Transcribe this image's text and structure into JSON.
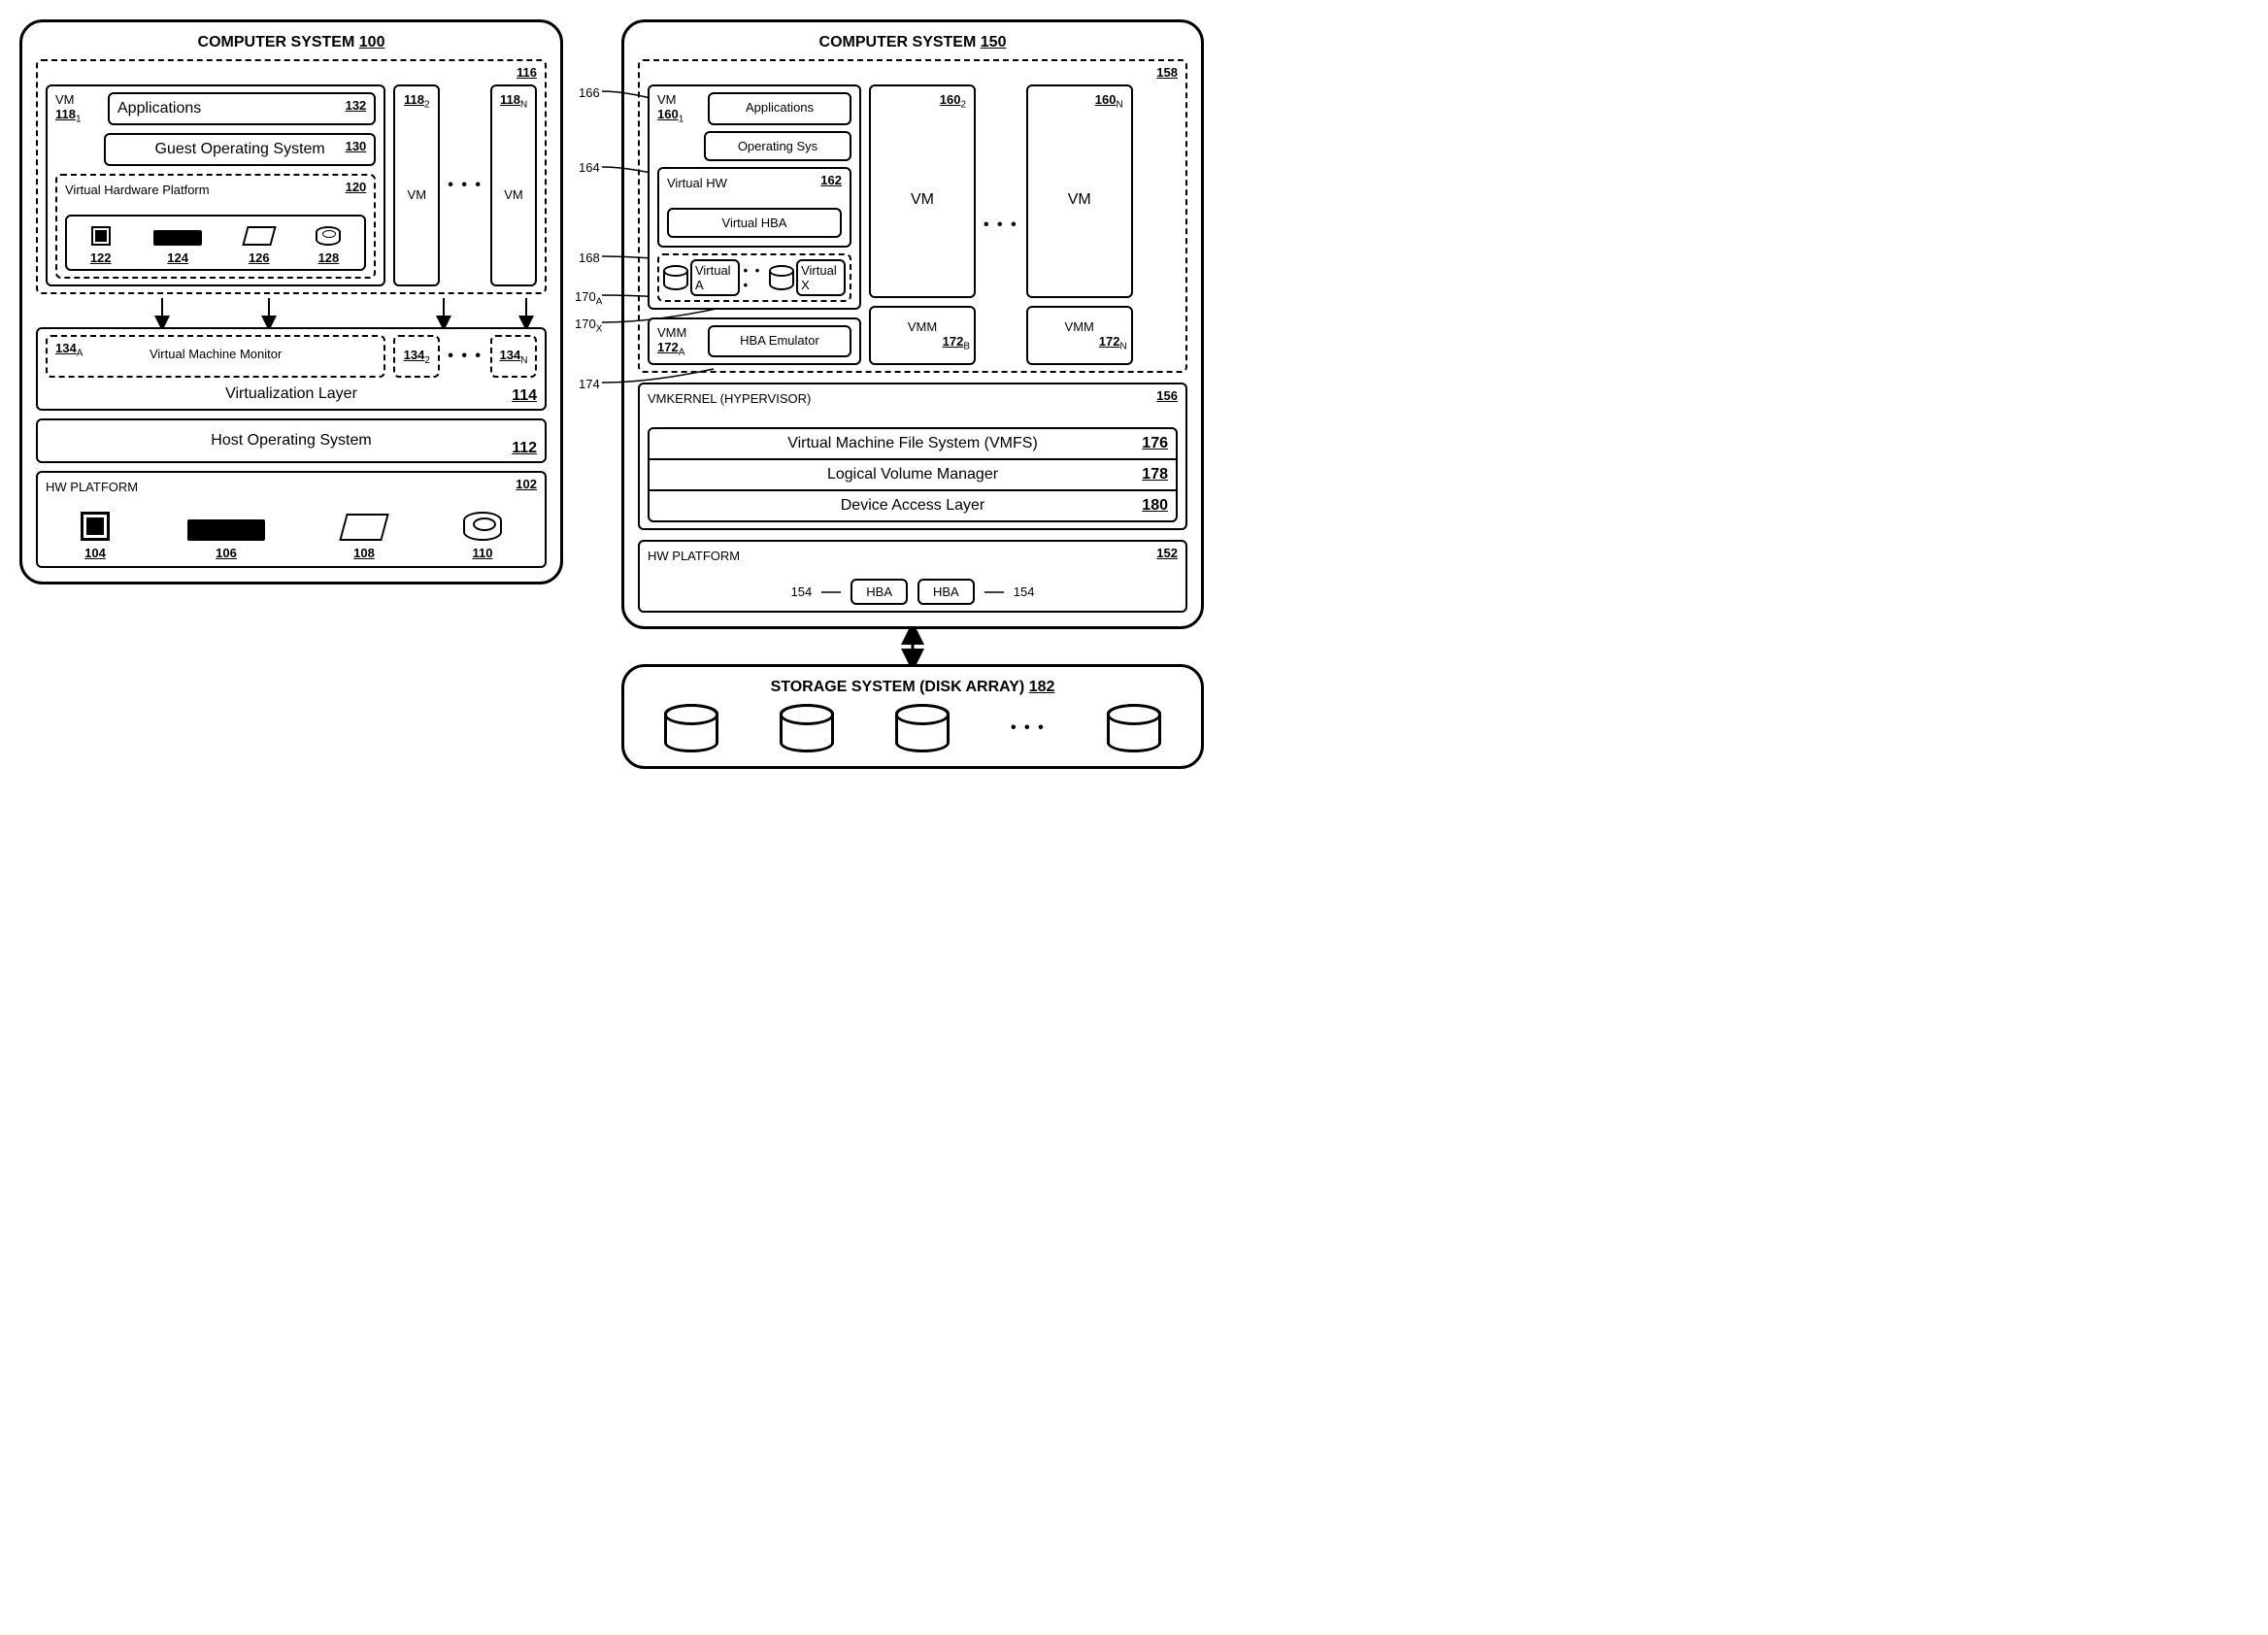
{
  "left": {
    "title_text": "COMPUTER SYSTEM",
    "title_ref": "100",
    "vm_group_ref": "116",
    "vm1": {
      "label": "VM",
      "ref": "118",
      "sub": "1"
    },
    "vm2": {
      "ref": "118",
      "sub": "2",
      "label": "VM"
    },
    "vmN": {
      "ref": "118",
      "sub": "N",
      "label": "VM"
    },
    "apps": {
      "label": "Applications",
      "ref": "132"
    },
    "guest_os": {
      "label": "Guest Operating System",
      "ref": "130"
    },
    "vhw": {
      "label": "Virtual Hardware Platform",
      "ref": "120"
    },
    "hw_122": "122",
    "hw_124": "124",
    "hw_126": "126",
    "hw_128": "128",
    "vmm": {
      "label": "Virtual Machine Monitor",
      "refA": "134",
      "subA": "A",
      "ref2": "134",
      "sub2": "2",
      "refN": "134",
      "subN": "N"
    },
    "virt_layer": {
      "label": "Virtualization Layer",
      "ref": "114"
    },
    "host_os": {
      "label": "Host Operating System",
      "ref": "112"
    },
    "hw_platform": {
      "label": "HW PLATFORM",
      "ref": "102"
    },
    "hwp_104": "104",
    "hwp_106": "106",
    "hwp_108": "108",
    "hwp_110": "110",
    "dots": "• • •"
  },
  "right": {
    "title_text": "COMPUTER SYSTEM",
    "title_ref": "150",
    "vm_group_ref": "158",
    "vm1": {
      "label": "VM",
      "ref": "160",
      "sub": "1"
    },
    "vm2": {
      "ref": "160",
      "sub": "2",
      "label": "VM"
    },
    "vmN": {
      "ref": "160",
      "sub": "N",
      "label": "VM"
    },
    "apps": "Applications",
    "os": "Operating Sys",
    "vhw": {
      "label": "Virtual HW",
      "ref": "162"
    },
    "vhba": "Virtual HBA",
    "vdiskA": "Virtual A",
    "vdiskX": "Virtual X",
    "dots_disks": "• • •",
    "vmm1": {
      "label": "VMM",
      "ref": "172",
      "sub": "A"
    },
    "vmm2": {
      "label": "VMM",
      "ref": "172",
      "sub": "B"
    },
    "vmmN": {
      "label": "VMM",
      "ref": "172",
      "sub": "N"
    },
    "hba_emu": "HBA Emulator",
    "vmkernel": {
      "label": "VMKERNEL (HYPERVISOR)",
      "ref": "156"
    },
    "vmfs": {
      "label": "Virtual Machine File System (VMFS)",
      "ref": "176"
    },
    "lvm": {
      "label": "Logical Volume Manager",
      "ref": "178"
    },
    "dal": {
      "label": "Device Access Layer",
      "ref": "180"
    },
    "hw_platform": {
      "label": "HW PLATFORM",
      "ref": "152"
    },
    "hba": "HBA",
    "hba_ref": "154",
    "storage": {
      "label": "STORAGE SYSTEM (DISK ARRAY)",
      "ref": "182"
    },
    "leads": {
      "l166": "166",
      "l164": "164",
      "l168": "168",
      "l170A": "170",
      "l170Asub": "A",
      "l170X": "170",
      "l170Xsub": "X",
      "l174": "174"
    },
    "dots": "• • •"
  }
}
